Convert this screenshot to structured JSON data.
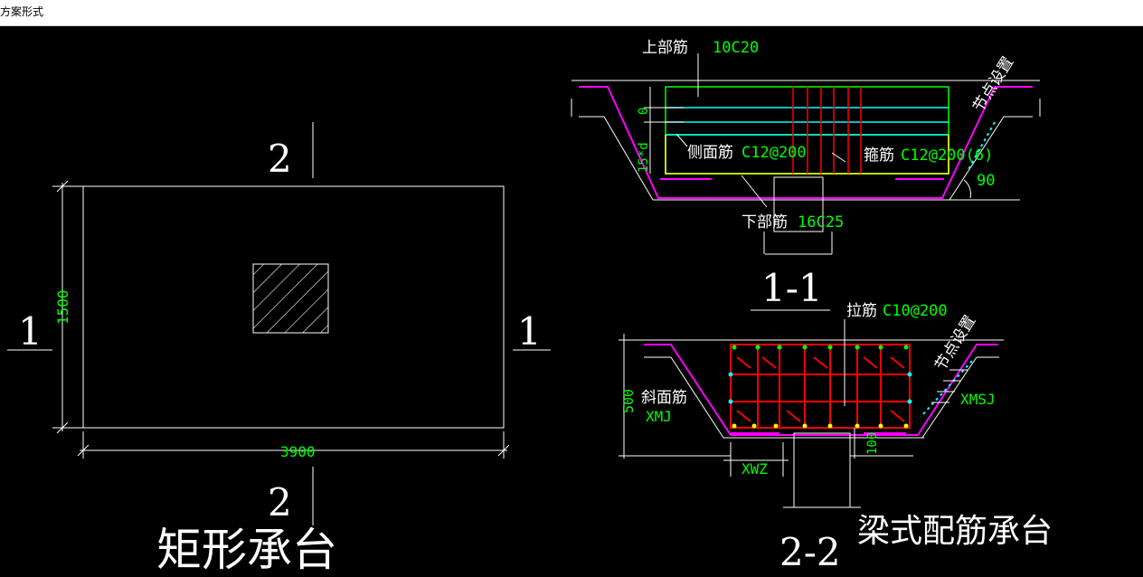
{
  "window": {
    "title": "方案形式"
  },
  "left_view": {
    "section_top": "2",
    "section_bottom": "2",
    "section_left": "1",
    "section_right": "1",
    "dim_height": "1500",
    "dim_width": "3900",
    "caption": "矩形承台"
  },
  "section_1_1": {
    "top_bar_label": "上部筋",
    "top_bar_value": "10C20",
    "side_bar_label": "侧面筋",
    "side_bar_value": "C12@200",
    "stirrup_label": "箍筋",
    "stirrup_value": "C12@200(6)",
    "bottom_bar_label": "下部筋",
    "bottom_bar_value": "16C25",
    "node_setting": "节点设置",
    "angle": "90",
    "dim_zero": "0",
    "dim_15d": "15*d",
    "section_label": "1-1"
  },
  "section_2_2": {
    "tie_bar_label": "拉筋",
    "tie_bar_value": "C10@200",
    "node_setting": "节点设置",
    "slope_bar_label": "斜面筋",
    "xmj": "XMJ",
    "xmsj": "XMSJ",
    "xwz": "XWZ",
    "dim_500": "500",
    "dim_100": "100",
    "section_label": "2-2",
    "caption": "梁式配筋承台"
  },
  "colors": {
    "line": "#ffffff",
    "annotation": "#00ff00",
    "rebar_main": "#00ff00",
    "rebar_cyan": "#00ffff",
    "rebar_red": "#ff0000",
    "rebar_yellow": "#ffff00",
    "rebar_magenta": "#ff00ff"
  }
}
